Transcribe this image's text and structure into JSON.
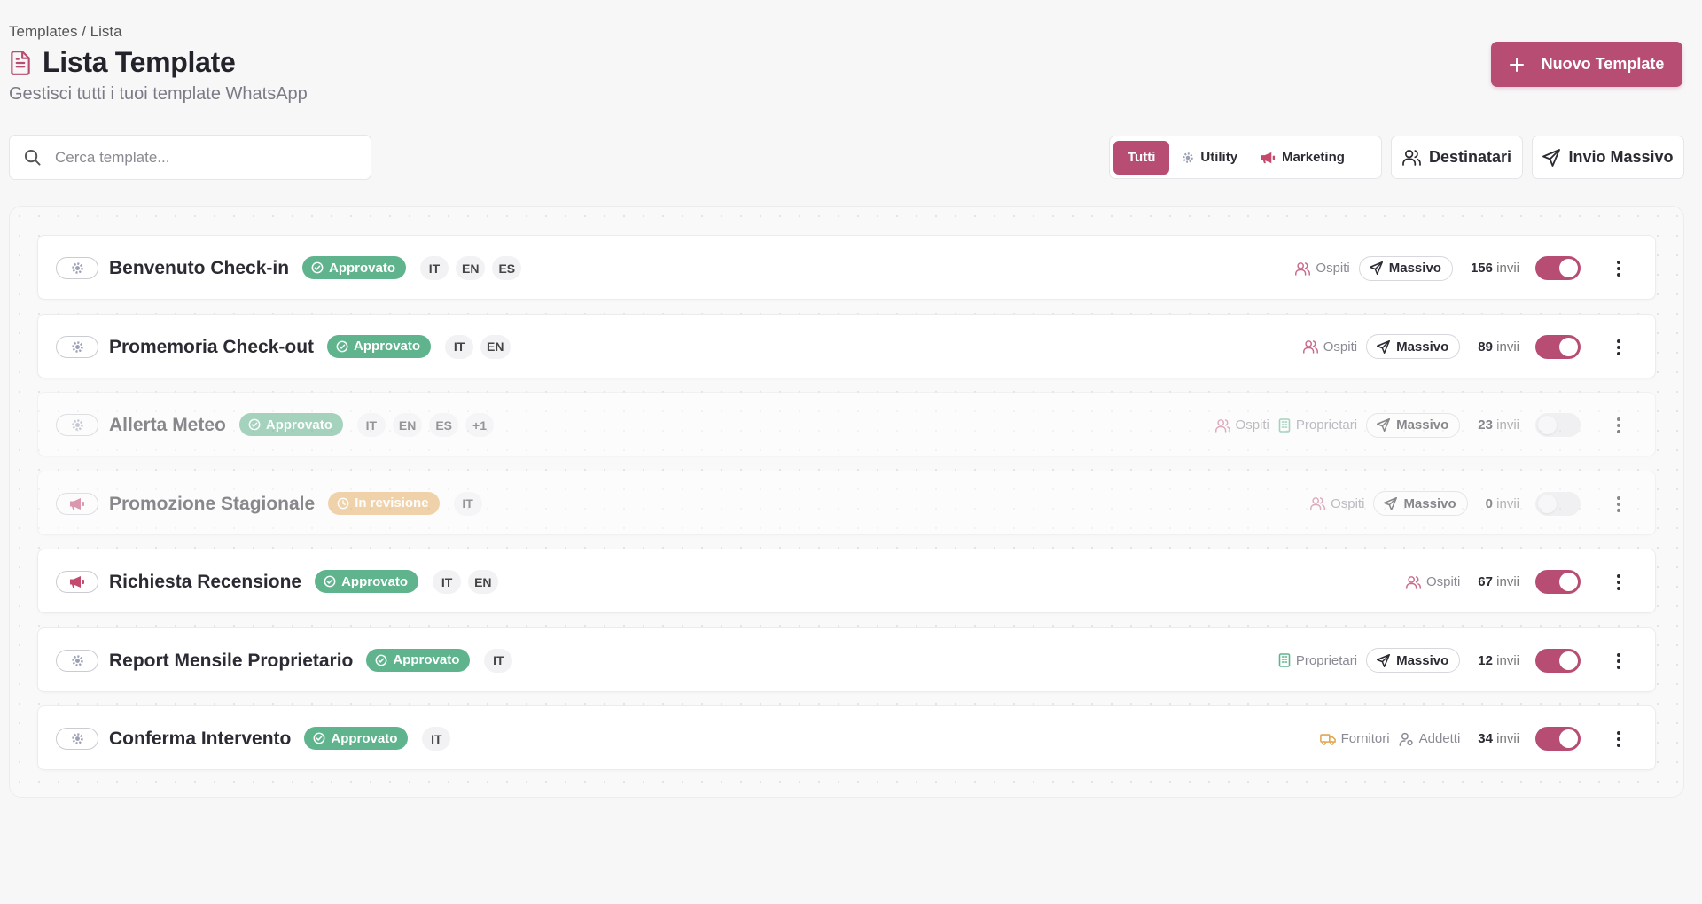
{
  "header": {
    "breadcrumb": "Templates / Lista",
    "title": "Lista Template",
    "subtitle": "Gestisci tutti i tuoi template WhatsApp",
    "new_button_label": "Nuovo Template"
  },
  "toolbar": {
    "search_placeholder": "Cerca template...",
    "filters": {
      "all": "Tutti",
      "utility": "Utility",
      "marketing": "Marketing"
    },
    "recipients_label": "Destinatari",
    "bulk_send_label": "Invio Massivo"
  },
  "colors": {
    "accent": "#b84d74",
    "approved": "#5fb48d",
    "in_review": "#eab46a"
  },
  "templates": [
    {
      "name": "Benvenuto Check-in",
      "type": "utility",
      "type_icon": "gear-icon",
      "status": "Approvato",
      "status_kind": "approved",
      "langs": [
        "IT",
        "EN",
        "ES"
      ],
      "audience": [
        "Ospiti"
      ],
      "massivo": "Massivo",
      "sends": "156",
      "sends_label": "invii",
      "enabled": true
    },
    {
      "name": "Promemoria Check-out",
      "type": "utility",
      "type_icon": "gear-icon",
      "status": "Approvato",
      "status_kind": "approved",
      "langs": [
        "IT",
        "EN"
      ],
      "audience": [
        "Ospiti"
      ],
      "massivo": "Massivo",
      "sends": "89",
      "sends_label": "invii",
      "enabled": true
    },
    {
      "name": "Allerta Meteo",
      "type": "utility",
      "type_icon": "gear-icon",
      "status": "Approvato",
      "status_kind": "approved",
      "langs": [
        "IT",
        "EN",
        "ES",
        "+1"
      ],
      "audience": [
        "Ospiti",
        "Proprietari"
      ],
      "massivo": "Massivo",
      "sends": "23",
      "sends_label": "invii",
      "enabled": false
    },
    {
      "name": "Promozione Stagionale",
      "type": "marketing",
      "type_icon": "megaphone-icon",
      "status": "In revisione",
      "status_kind": "review",
      "langs": [
        "IT"
      ],
      "audience": [
        "Ospiti"
      ],
      "massivo": "Massivo",
      "sends": "0",
      "sends_label": "invii",
      "enabled": false
    },
    {
      "name": "Richiesta Recensione",
      "type": "marketing",
      "type_icon": "megaphone-icon",
      "status": "Approvato",
      "status_kind": "approved",
      "langs": [
        "IT",
        "EN"
      ],
      "audience": [
        "Ospiti"
      ],
      "massivo": "",
      "sends": "67",
      "sends_label": "invii",
      "enabled": true
    },
    {
      "name": "Report Mensile Proprietario",
      "type": "utility",
      "type_icon": "gear-icon",
      "status": "Approvato",
      "status_kind": "approved",
      "langs": [
        "IT"
      ],
      "audience": [
        "Proprietari"
      ],
      "massivo": "Massivo",
      "sends": "12",
      "sends_label": "invii",
      "enabled": true
    },
    {
      "name": "Conferma Intervento",
      "type": "utility",
      "type_icon": "gear-icon",
      "status": "Approvato",
      "status_kind": "approved",
      "langs": [
        "IT"
      ],
      "audience": [
        "Fornitori",
        "Addetti"
      ],
      "massivo": "",
      "sends": "34",
      "sends_label": "invii",
      "enabled": true
    }
  ]
}
